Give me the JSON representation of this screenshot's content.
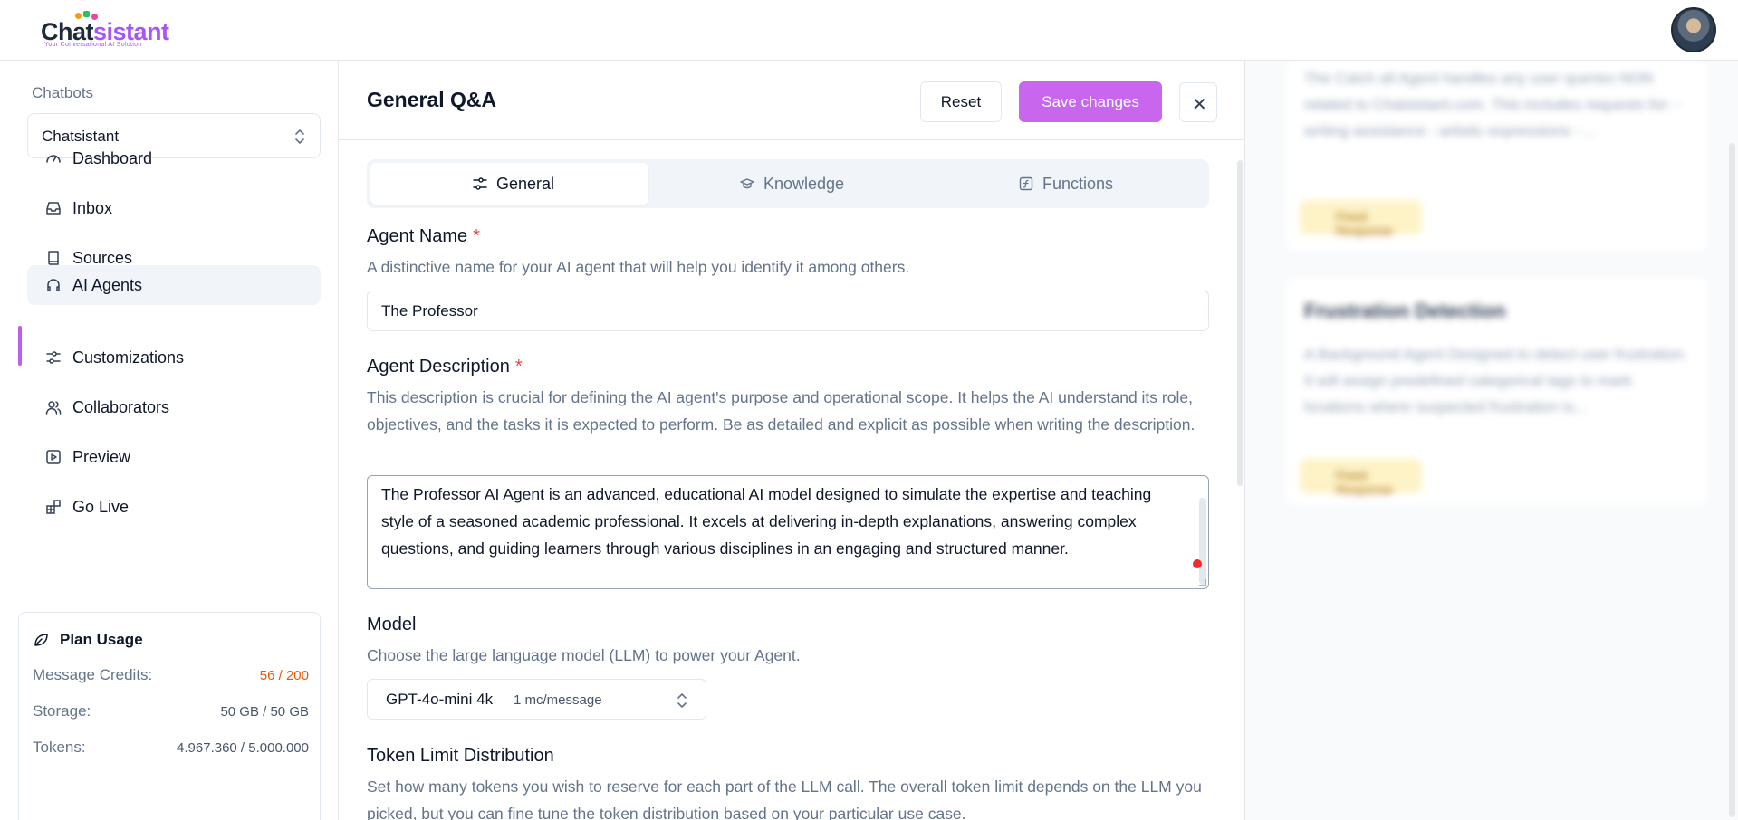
{
  "brand": {
    "name_prefix": "Chat",
    "name_suffix": "sistant",
    "tagline": "Your Conversational AI Solution",
    "accent_color": "#c867ee"
  },
  "sidebar": {
    "chatbots_label": "Chatbots",
    "selected_chatbot": "Chatsistant",
    "items": [
      {
        "label": "Dashboard",
        "icon": "gauge-icon"
      },
      {
        "label": "Inbox",
        "icon": "inbox-icon"
      },
      {
        "label": "Sources",
        "icon": "book-icon"
      },
      {
        "label": "AI Agents",
        "icon": "headset-icon",
        "active": true
      },
      {
        "label": "Customizations",
        "icon": "sliders-icon"
      },
      {
        "label": "Collaborators",
        "icon": "users-icon"
      },
      {
        "label": "Preview",
        "icon": "play-square-icon"
      },
      {
        "label": "Go Live",
        "icon": "blocks-icon"
      }
    ],
    "plan": {
      "title": "Plan Usage",
      "message_credits_label": "Message Credits:",
      "message_credits_value": "56 / 200",
      "storage_label": "Storage:",
      "storage_value": "50 GB / 50 GB",
      "tokens_label": "Tokens:",
      "tokens_value": "4.967.360 / 5.000.000"
    }
  },
  "main": {
    "title": "General Q&A",
    "reset_label": "Reset",
    "save_label": "Save changes",
    "close_label": "✕",
    "tabs": [
      {
        "label": "General",
        "active": true
      },
      {
        "label": "Knowledge"
      },
      {
        "label": "Functions"
      }
    ],
    "agent_name": {
      "title": "Agent Name",
      "required_mark": "*",
      "description": "A distinctive name for your AI agent that will help you identify it among others.",
      "value": "The Professor"
    },
    "agent_description": {
      "title": "Agent Description",
      "required_mark": "*",
      "description": "This description is crucial for defining the AI agent's purpose and operational scope. It helps the AI understand its role, objectives, and the tasks it is expected to perform. Be as detailed and explicit as possible when writing the description.",
      "value": "The Professor AI Agent is an advanced, educational AI model designed to simulate the expertise and teaching style of a seasoned academic professional. It excels at delivering in-depth explanations, answering complex questions, and guiding learners through various disciplines in an engaging and structured manner."
    },
    "model": {
      "title": "Model",
      "description": "Choose the large language model (LLM) to power your Agent.",
      "value": "GPT-4o-mini 4k",
      "cost": "1 mc/message"
    },
    "token_limit": {
      "title": "Token Limit Distribution",
      "description": "Set how many tokens you wish to reserve for each part of the LLM call. The overall token limit depends on the LLM you picked, but you can fine tune the token distribution based on your particular use case."
    }
  },
  "right_panel": {
    "cards": [
      {
        "title": "",
        "description": "The Catch all Agent handles any user queries NON related to Chatsistant.com. This includes requests for: - writing assistance - artistic expressions - ...",
        "badge": "Fixed Response"
      },
      {
        "title": "Frustration Detection",
        "description": "A Background Agent Designed to detect user frustration. It will assign predefined categorical tags to mark locations where suspected frustration is...",
        "badge": "Fixed Response"
      }
    ]
  }
}
